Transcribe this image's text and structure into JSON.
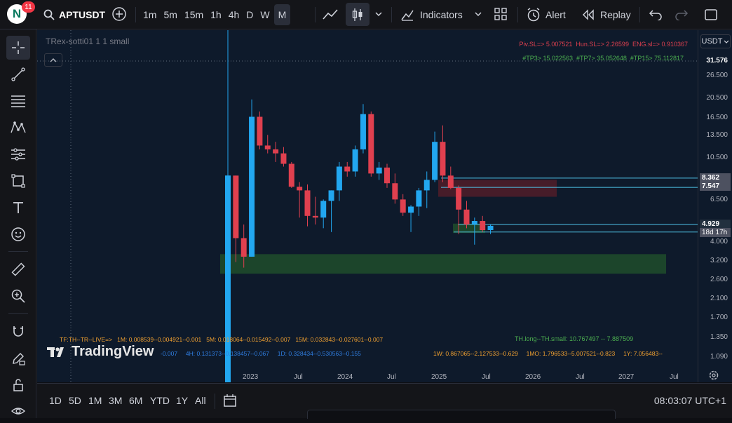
{
  "topbar": {
    "avatar_letter": "N",
    "notifications": "11",
    "symbol": "APTUSDT",
    "intervals": [
      "1m",
      "5m",
      "15m",
      "1h",
      "4h",
      "D",
      "W",
      "M"
    ],
    "active_interval": "M",
    "indicators_label": "Indicators",
    "alert_label": "Alert",
    "replay_label": "Replay"
  },
  "legend": {
    "indicator_name": "TRex-sotti01 1 1 small"
  },
  "info_lines": {
    "sl_line": "Piv.SL=> 5.007521  Hun.SL=> 2.26599  ENG.sl=> 0.910367",
    "tp_line": "#TP3> 15.022563  #TP7> 35.052648  #TP15> 75.112817",
    "tf_line": "TF:TH--TR--LIVE=>   1M: 0.008539--0.004921--0.001   5M: 0.018064--0.015492--0.007   15M: 0.032843--0.027601--0.007",
    "th_line": "TH.long--TH.small: 10.767497 -- 7.887509",
    "h_line": "-0.007     4H: 0.131373--0.138457--0.067     1D: 0.328434--0.530563--0.155",
    "w_line": "1W: 0.867065--2.127533--0.629     1MO: 1.796533--5.007521--0.823     1Y: 7.056483--"
  },
  "watermark": "TradingView",
  "price_axis": {
    "currency": "USDT",
    "labels": [
      "31.576",
      "26.500",
      "20.500",
      "16.500",
      "13.500",
      "10.500",
      "8.500",
      "6.500",
      "4.000",
      "3.200",
      "2.600",
      "2.100",
      "1.700",
      "1.350",
      "1.090"
    ],
    "tag_8362": "8.362",
    "tag_7547": "7.547",
    "last_price": "4.929",
    "countdown": "18d 17h"
  },
  "time_axis": {
    "labels": [
      "2023",
      "Jul",
      "2024",
      "Jul",
      "2025",
      "Jul",
      "2026",
      "Jul",
      "2027",
      "Jul"
    ]
  },
  "bottombar": {
    "ranges": [
      "1D",
      "5D",
      "1M",
      "3M",
      "6M",
      "YTD",
      "1Y",
      "All"
    ],
    "clock": "08:03:07 UTC+1"
  },
  "colors": {
    "up": "#22a7f0",
    "down": "#e0404f",
    "bg": "#0e1a2b",
    "zone_green": "#1e4d2b",
    "zone_red": "#5a1e2a"
  },
  "chart_data": {
    "type": "candlestick",
    "interval": "M",
    "candles": [
      {
        "o": 0.9,
        "h": 31.5,
        "l": 0.9,
        "c": 8.6,
        "dir": "up"
      },
      {
        "o": 8.6,
        "h": 8.6,
        "l": 3.3,
        "c": 4.3,
        "dir": "down"
      },
      {
        "o": 4.3,
        "h": 5.0,
        "l": 3.1,
        "c": 3.5,
        "dir": "down"
      },
      {
        "o": 3.5,
        "h": 20.0,
        "l": 3.5,
        "c": 16.5,
        "dir": "up"
      },
      {
        "o": 16.5,
        "h": 17.5,
        "l": 11.5,
        "c": 12.0,
        "dir": "down"
      },
      {
        "o": 12.0,
        "h": 13.5,
        "l": 11.0,
        "c": 11.5,
        "dir": "down"
      },
      {
        "o": 11.5,
        "h": 12.5,
        "l": 10.0,
        "c": 11.0,
        "dir": "down"
      },
      {
        "o": 11.0,
        "h": 11.8,
        "l": 9.5,
        "c": 9.8,
        "dir": "down"
      },
      {
        "o": 9.8,
        "h": 10.0,
        "l": 7.5,
        "c": 7.6,
        "dir": "down"
      },
      {
        "o": 7.6,
        "h": 8.0,
        "l": 5.4,
        "c": 7.3,
        "dir": "down"
      },
      {
        "o": 7.3,
        "h": 7.8,
        "l": 4.9,
        "c": 5.5,
        "dir": "down"
      },
      {
        "o": 5.5,
        "h": 6.8,
        "l": 5.0,
        "c": 5.4,
        "dir": "down"
      },
      {
        "o": 5.4,
        "h": 6.6,
        "l": 4.8,
        "c": 6.5,
        "dir": "up"
      },
      {
        "o": 6.5,
        "h": 7.3,
        "l": 4.6,
        "c": 7.3,
        "dir": "up"
      },
      {
        "o": 7.3,
        "h": 10.0,
        "l": 6.5,
        "c": 9.5,
        "dir": "up"
      },
      {
        "o": 9.5,
        "h": 10.0,
        "l": 8.5,
        "c": 9.0,
        "dir": "down"
      },
      {
        "o": 9.0,
        "h": 12.0,
        "l": 8.5,
        "c": 11.5,
        "dir": "up"
      },
      {
        "o": 11.5,
        "h": 19.0,
        "l": 11.0,
        "c": 17.0,
        "dir": "up"
      },
      {
        "o": 17.0,
        "h": 17.5,
        "l": 8.5,
        "c": 8.8,
        "dir": "down"
      },
      {
        "o": 8.8,
        "h": 10.0,
        "l": 8.2,
        "c": 9.4,
        "dir": "up"
      },
      {
        "o": 9.4,
        "h": 9.8,
        "l": 7.5,
        "c": 7.9,
        "dir": "down"
      },
      {
        "o": 7.9,
        "h": 8.8,
        "l": 6.3,
        "c": 6.6,
        "dir": "down"
      },
      {
        "o": 6.6,
        "h": 7.0,
        "l": 5.5,
        "c": 5.7,
        "dir": "down"
      },
      {
        "o": 5.7,
        "h": 6.2,
        "l": 4.6,
        "c": 6.1,
        "dir": "up"
      },
      {
        "o": 6.1,
        "h": 7.5,
        "l": 5.5,
        "c": 7.3,
        "dir": "up"
      },
      {
        "o": 7.3,
        "h": 9.0,
        "l": 6.0,
        "c": 8.2,
        "dir": "up"
      },
      {
        "o": 8.2,
        "h": 14.0,
        "l": 8.0,
        "c": 12.5,
        "dir": "up"
      },
      {
        "o": 12.5,
        "h": 15.0,
        "l": 8.0,
        "c": 8.6,
        "dir": "down"
      },
      {
        "o": 8.6,
        "h": 9.5,
        "l": 7.4,
        "c": 7.5,
        "dir": "down"
      },
      {
        "o": 7.5,
        "h": 7.7,
        "l": 4.5,
        "c": 5.9,
        "dir": "down"
      },
      {
        "o": 5.9,
        "h": 6.5,
        "l": 4.8,
        "c": 5.0,
        "dir": "down"
      },
      {
        "o": 5.0,
        "h": 5.4,
        "l": 4.0,
        "c": 5.2,
        "dir": "up"
      },
      {
        "o": 5.2,
        "h": 5.5,
        "l": 4.6,
        "c": 4.7,
        "dir": "down"
      },
      {
        "o": 4.7,
        "h": 5.0,
        "l": 4.5,
        "c": 4.929,
        "dir": "up"
      }
    ],
    "zones": [
      {
        "from": 2.9,
        "to": 3.6,
        "color": "green"
      },
      {
        "from": 6.8,
        "to": 8.2,
        "color": "red"
      },
      {
        "from": 4.55,
        "to": 5.05,
        "color": "green"
      }
    ],
    "hlines": [
      8.362,
      7.547,
      5.0,
      4.6
    ],
    "ylim": [
      1.0,
      32.0
    ],
    "scale": "log",
    "grid": false
  }
}
